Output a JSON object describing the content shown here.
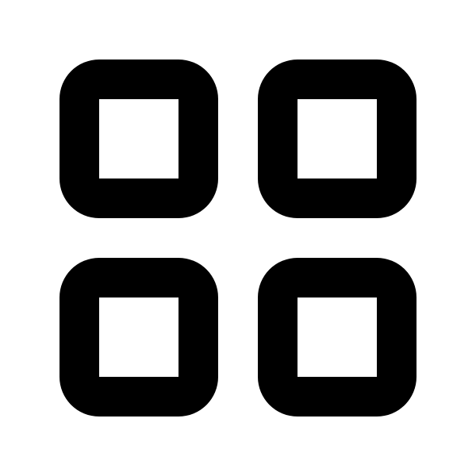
{
  "icon": {
    "name": "grid-icon",
    "description_tiles": 4,
    "fill_color": "#000000",
    "background_color": "#ffffff"
  }
}
